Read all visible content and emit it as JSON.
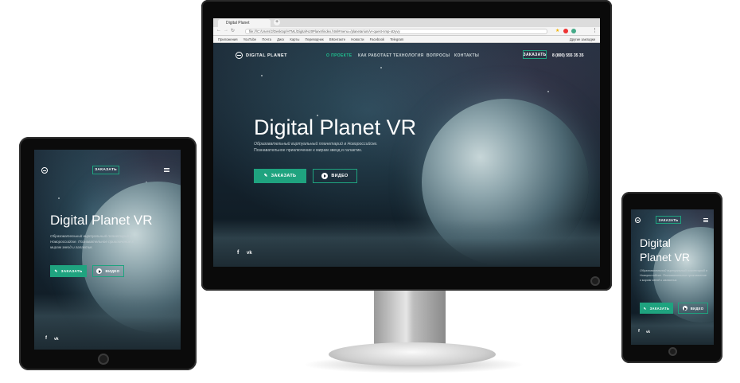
{
  "browser": {
    "tab_title": "Digital Planet",
    "url": "file:///C:/Users/2/Desktop/HTML/Digital%20Planet/index.html#menu=/planetarium/vr-quest-nmp-otzyvy",
    "bookmarks": [
      "Приложения",
      "YouTube",
      "Почта",
      "Диск",
      "Карты",
      "Переводчик",
      "ВКонтакте",
      "Новости",
      "Facebook",
      "Telegram",
      "Другие закладки"
    ]
  },
  "site": {
    "brand": "DIGITAL PLANET",
    "nav": [
      "О ПРОЕКТЕ",
      "КАК РАБОТАЕТ",
      "ТЕХНОЛОГИЯ",
      "ВОПРОСЫ",
      "КОНТАКТЫ"
    ],
    "header_button": "ЗАКАЗАТЬ",
    "phone": "8 (800) 555 35 35",
    "hero_title": "Digital Planet VR",
    "hero_title_line1": "Digital",
    "hero_title_line2": "Planet VR",
    "hero_subtitle_line1": "Образовательный виртуальный планетарий в Новороссийске.",
    "hero_subtitle_line2": "Познавательное приключение к мирам звезд и галактик.",
    "order_button": "ЗАКАЗАТЬ",
    "video_button": "ВИДЕО",
    "social_fb": "f",
    "social_vk": "vk"
  },
  "colors": {
    "accent": "#1fa37f",
    "accent_active": "#1fc08f",
    "bezel": "#0b0b0b"
  }
}
